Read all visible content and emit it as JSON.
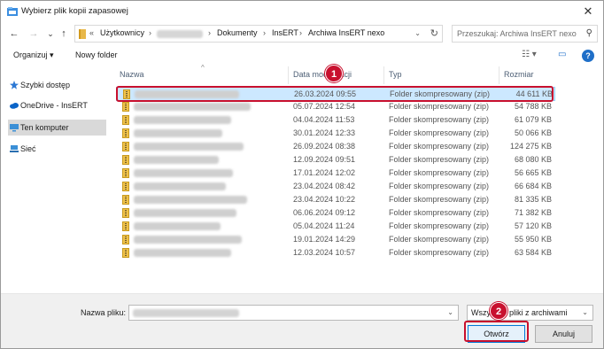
{
  "window": {
    "title": "Wybierz plik kopii zapasowej",
    "close_glyph": "✕"
  },
  "nav": {
    "back_glyph": "←",
    "forward_glyph": "→",
    "recent_glyph": "⌄",
    "up_glyph": "↑",
    "breadcrumb_overflow": "«",
    "breadcrumb": [
      "Użytkownicy",
      "Dokumenty",
      "InsERT",
      "Archiwa InsERT nexo"
    ],
    "separator": "›",
    "dropdown_glyph": "⌄",
    "refresh_glyph": "↻",
    "search_placeholder": "Przeszukaj: Archiwa InsERT nexo",
    "search_glyph": "⚲"
  },
  "toolbar": {
    "organize_label": "Organizuj ▾",
    "new_folder_label": "Nowy folder",
    "view_glyph": "☷ ▾",
    "pane_glyph": "▭",
    "help_glyph": "?"
  },
  "sidebar": {
    "items": [
      {
        "label": "Szybki dostęp",
        "icon": "star-icon",
        "color": "#2b78d4"
      },
      {
        "label": "OneDrive - InsERT",
        "icon": "cloud-icon",
        "color": "#0a64c8"
      },
      {
        "label": "Ten komputer",
        "icon": "computer-icon",
        "color": "#3a8fd6",
        "selected": true
      },
      {
        "label": "Sieć",
        "icon": "network-icon",
        "color": "#3a8fd6"
      }
    ]
  },
  "columns": {
    "name": "Nazwa",
    "date": "Data modyfikacji",
    "type": "Typ",
    "size": "Rozmiar",
    "sort_glyph": "^"
  },
  "files": [
    {
      "date": "26.03.2024 09:55",
      "type": "Folder skompresowany (zip)",
      "size": "44 611 KB",
      "selected": true
    },
    {
      "date": "05.07.2024 12:54",
      "type": "Folder skompresowany (zip)",
      "size": "54 788 KB"
    },
    {
      "date": "04.04.2024 11:53",
      "type": "Folder skompresowany (zip)",
      "size": "61 079 KB"
    },
    {
      "date": "30.01.2024 12:33",
      "type": "Folder skompresowany (zip)",
      "size": "50 066 KB"
    },
    {
      "date": "26.09.2024 08:38",
      "type": "Folder skompresowany (zip)",
      "size": "124 275 KB"
    },
    {
      "date": "12.09.2024 09:51",
      "type": "Folder skompresowany (zip)",
      "size": "68 080 KB"
    },
    {
      "date": "17.01.2024 12:02",
      "type": "Folder skompresowany (zip)",
      "size": "56 665 KB"
    },
    {
      "date": "23.04.2024 08:42",
      "type": "Folder skompresowany (zip)",
      "size": "66 684 KB"
    },
    {
      "date": "23.04.2024 10:22",
      "type": "Folder skompresowany (zip)",
      "size": "81 335 KB"
    },
    {
      "date": "06.06.2024 09:12",
      "type": "Folder skompresowany (zip)",
      "size": "71 382 KB"
    },
    {
      "date": "05.04.2024 11:24",
      "type": "Folder skompresowany (zip)",
      "size": "57 120 KB"
    },
    {
      "date": "19.01.2024 14:29",
      "type": "Folder skompresowany (zip)",
      "size": "55 950 KB"
    },
    {
      "date": "12.03.2024 10:57",
      "type": "Folder skompresowany (zip)",
      "size": "63 584 KB"
    }
  ],
  "bottom": {
    "filename_label": "Nazwa pliku:",
    "filename_dd_glyph": "⌄",
    "filetype_value": "Wszystkie pliki z archiwami",
    "filetype_dd_glyph": "⌄",
    "open_label": "Otwórz",
    "cancel_label": "Anuluj"
  },
  "annotations": {
    "badge_1": "1",
    "badge_2": "2",
    "color": "#c8102e"
  }
}
